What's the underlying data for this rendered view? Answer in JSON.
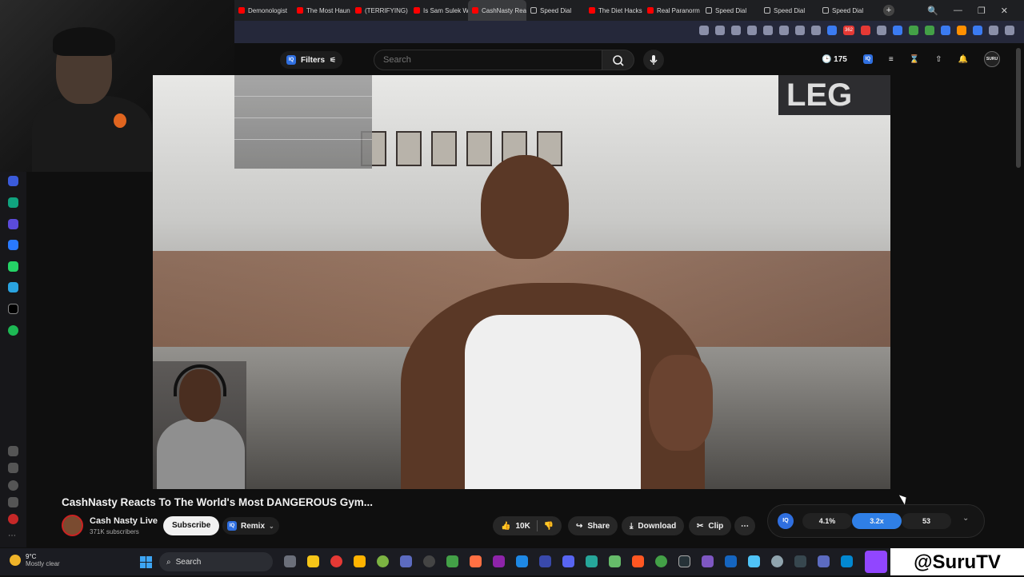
{
  "browser": {
    "tabs": [
      {
        "label": "Demonologist",
        "icon": "youtube-icon",
        "active": false
      },
      {
        "label": "The Most Haun",
        "icon": "youtube-icon",
        "active": false
      },
      {
        "label": "(TERRIFYING) D",
        "icon": "youtube-icon",
        "active": false
      },
      {
        "label": "Is Sam Sulek W",
        "icon": "youtube-icon",
        "active": false
      },
      {
        "label": "CashNasty Reacts To",
        "icon": "youtube-icon",
        "active": true
      },
      {
        "label": "Speed Dial",
        "icon": "speed-dial-icon",
        "active": false
      },
      {
        "label": "The Diet Hacks",
        "icon": "youtube-icon",
        "active": false
      },
      {
        "label": "Real Paranorm",
        "icon": "youtube-icon",
        "active": false
      },
      {
        "label": "Speed Dial",
        "icon": "speed-dial-icon",
        "active": false
      },
      {
        "label": "Speed Dial",
        "icon": "speed-dial-icon",
        "active": false
      },
      {
        "label": "Speed Dial",
        "icon": "speed-dial-icon",
        "active": false
      }
    ],
    "new_tab": "+",
    "window_controls": [
      "🔍",
      "—",
      "❐",
      "✕"
    ],
    "ext_badge": "362"
  },
  "youtube": {
    "filters_label": "Filters",
    "filters_badge": "IQ",
    "search_placeholder": "Search",
    "counter": "175",
    "avatar_label": "SURU",
    "video": {
      "banner_text": "LEG",
      "title": "CashNasty Reacts To The World's Most DANGEROUS Gym...",
      "channel": "Cash Nasty Live",
      "subscribers": "371K subscribers",
      "subscribe_label": "Subscribe",
      "remix_label": "Remix",
      "likes": "10K",
      "share_label": "Share",
      "download_label": "Download",
      "clip_label": "Clip",
      "more_label": "⋯"
    },
    "ext_panel": {
      "logo": "IQ",
      "stat1": "4.1%",
      "stat2": "3.2x",
      "stat3": "53",
      "chevron": "⌄"
    }
  },
  "taskbar": {
    "temperature": "9°C",
    "condition": "Mostly clear",
    "search_label": "Search",
    "brand": "@SuruTV"
  },
  "colors": {
    "accent_blue": "#2f7fe6",
    "youtube_red": "#ff0000",
    "twitch_purple": "#9146ff"
  }
}
